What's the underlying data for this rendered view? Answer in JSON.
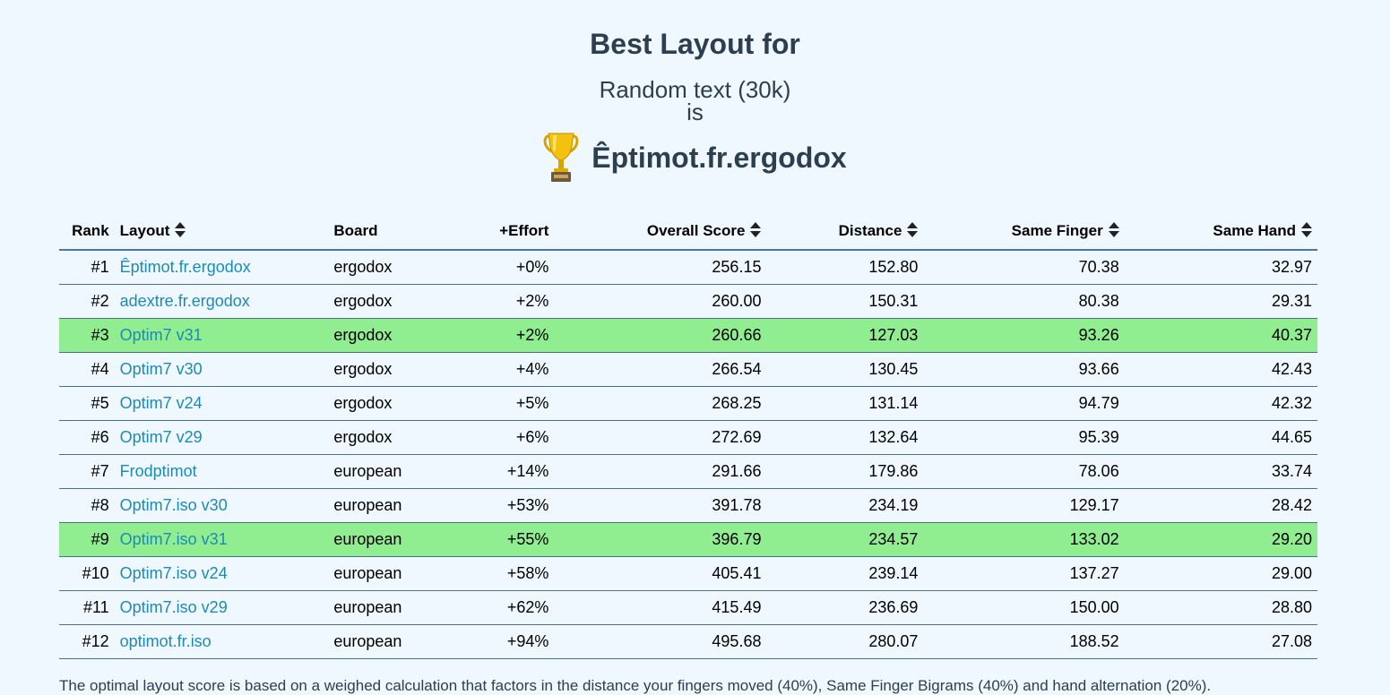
{
  "header": {
    "title": "Best Layout for",
    "corpus": "Random text (30k)",
    "is": "is",
    "trophy_icon": "trophy-icon",
    "winner": "Êptimot.fr.ergodox"
  },
  "table": {
    "columns": {
      "rank": "Rank",
      "layout": "Layout",
      "board": "Board",
      "effort": "+Effort",
      "overall": "Overall Score",
      "distance": "Distance",
      "same_finger": "Same Finger",
      "same_hand": "Same Hand"
    },
    "highlight_color": "#90ee90",
    "link_color": "#1a8bb8",
    "rows": [
      {
        "rank": "#1",
        "layout": "Êptimot.fr.ergodox",
        "board": "ergodox",
        "effort": "+0%",
        "overall": "256.15",
        "distance": "152.80",
        "same_finger": "70.38",
        "same_hand": "32.97",
        "highlight": false
      },
      {
        "rank": "#2",
        "layout": "adextre.fr.ergodox",
        "board": "ergodox",
        "effort": "+2%",
        "overall": "260.00",
        "distance": "150.31",
        "same_finger": "80.38",
        "same_hand": "29.31",
        "highlight": false
      },
      {
        "rank": "#3",
        "layout": "Optim7 v31",
        "board": "ergodox",
        "effort": "+2%",
        "overall": "260.66",
        "distance": "127.03",
        "same_finger": "93.26",
        "same_hand": "40.37",
        "highlight": true
      },
      {
        "rank": "#4",
        "layout": "Optim7 v30",
        "board": "ergodox",
        "effort": "+4%",
        "overall": "266.54",
        "distance": "130.45",
        "same_finger": "93.66",
        "same_hand": "42.43",
        "highlight": false
      },
      {
        "rank": "#5",
        "layout": "Optim7 v24",
        "board": "ergodox",
        "effort": "+5%",
        "overall": "268.25",
        "distance": "131.14",
        "same_finger": "94.79",
        "same_hand": "42.32",
        "highlight": false
      },
      {
        "rank": "#6",
        "layout": "Optim7 v29",
        "board": "ergodox",
        "effort": "+6%",
        "overall": "272.69",
        "distance": "132.64",
        "same_finger": "95.39",
        "same_hand": "44.65",
        "highlight": false
      },
      {
        "rank": "#7",
        "layout": "Frodptimot",
        "board": "european",
        "effort": "+14%",
        "overall": "291.66",
        "distance": "179.86",
        "same_finger": "78.06",
        "same_hand": "33.74",
        "highlight": false
      },
      {
        "rank": "#8",
        "layout": "Optim7.iso v30",
        "board": "european",
        "effort": "+53%",
        "overall": "391.78",
        "distance": "234.19",
        "same_finger": "129.17",
        "same_hand": "28.42",
        "highlight": false
      },
      {
        "rank": "#9",
        "layout": "Optim7.iso v31",
        "board": "european",
        "effort": "+55%",
        "overall": "396.79",
        "distance": "234.57",
        "same_finger": "133.02",
        "same_hand": "29.20",
        "highlight": true
      },
      {
        "rank": "#10",
        "layout": "Optim7.iso v24",
        "board": "european",
        "effort": "+58%",
        "overall": "405.41",
        "distance": "239.14",
        "same_finger": "137.27",
        "same_hand": "29.00",
        "highlight": false
      },
      {
        "rank": "#11",
        "layout": "Optim7.iso v29",
        "board": "european",
        "effort": "+62%",
        "overall": "415.49",
        "distance": "236.69",
        "same_finger": "150.00",
        "same_hand": "28.80",
        "highlight": false
      },
      {
        "rank": "#12",
        "layout": "optimot.fr.iso",
        "board": "european",
        "effort": "+94%",
        "overall": "495.68",
        "distance": "280.07",
        "same_finger": "188.52",
        "same_hand": "27.08",
        "highlight": false
      }
    ]
  },
  "footnote": "The optimal layout score is based on a weighed calculation that factors in the distance your fingers moved (40%), Same Finger Bigrams (40%) and hand alternation (20%)."
}
